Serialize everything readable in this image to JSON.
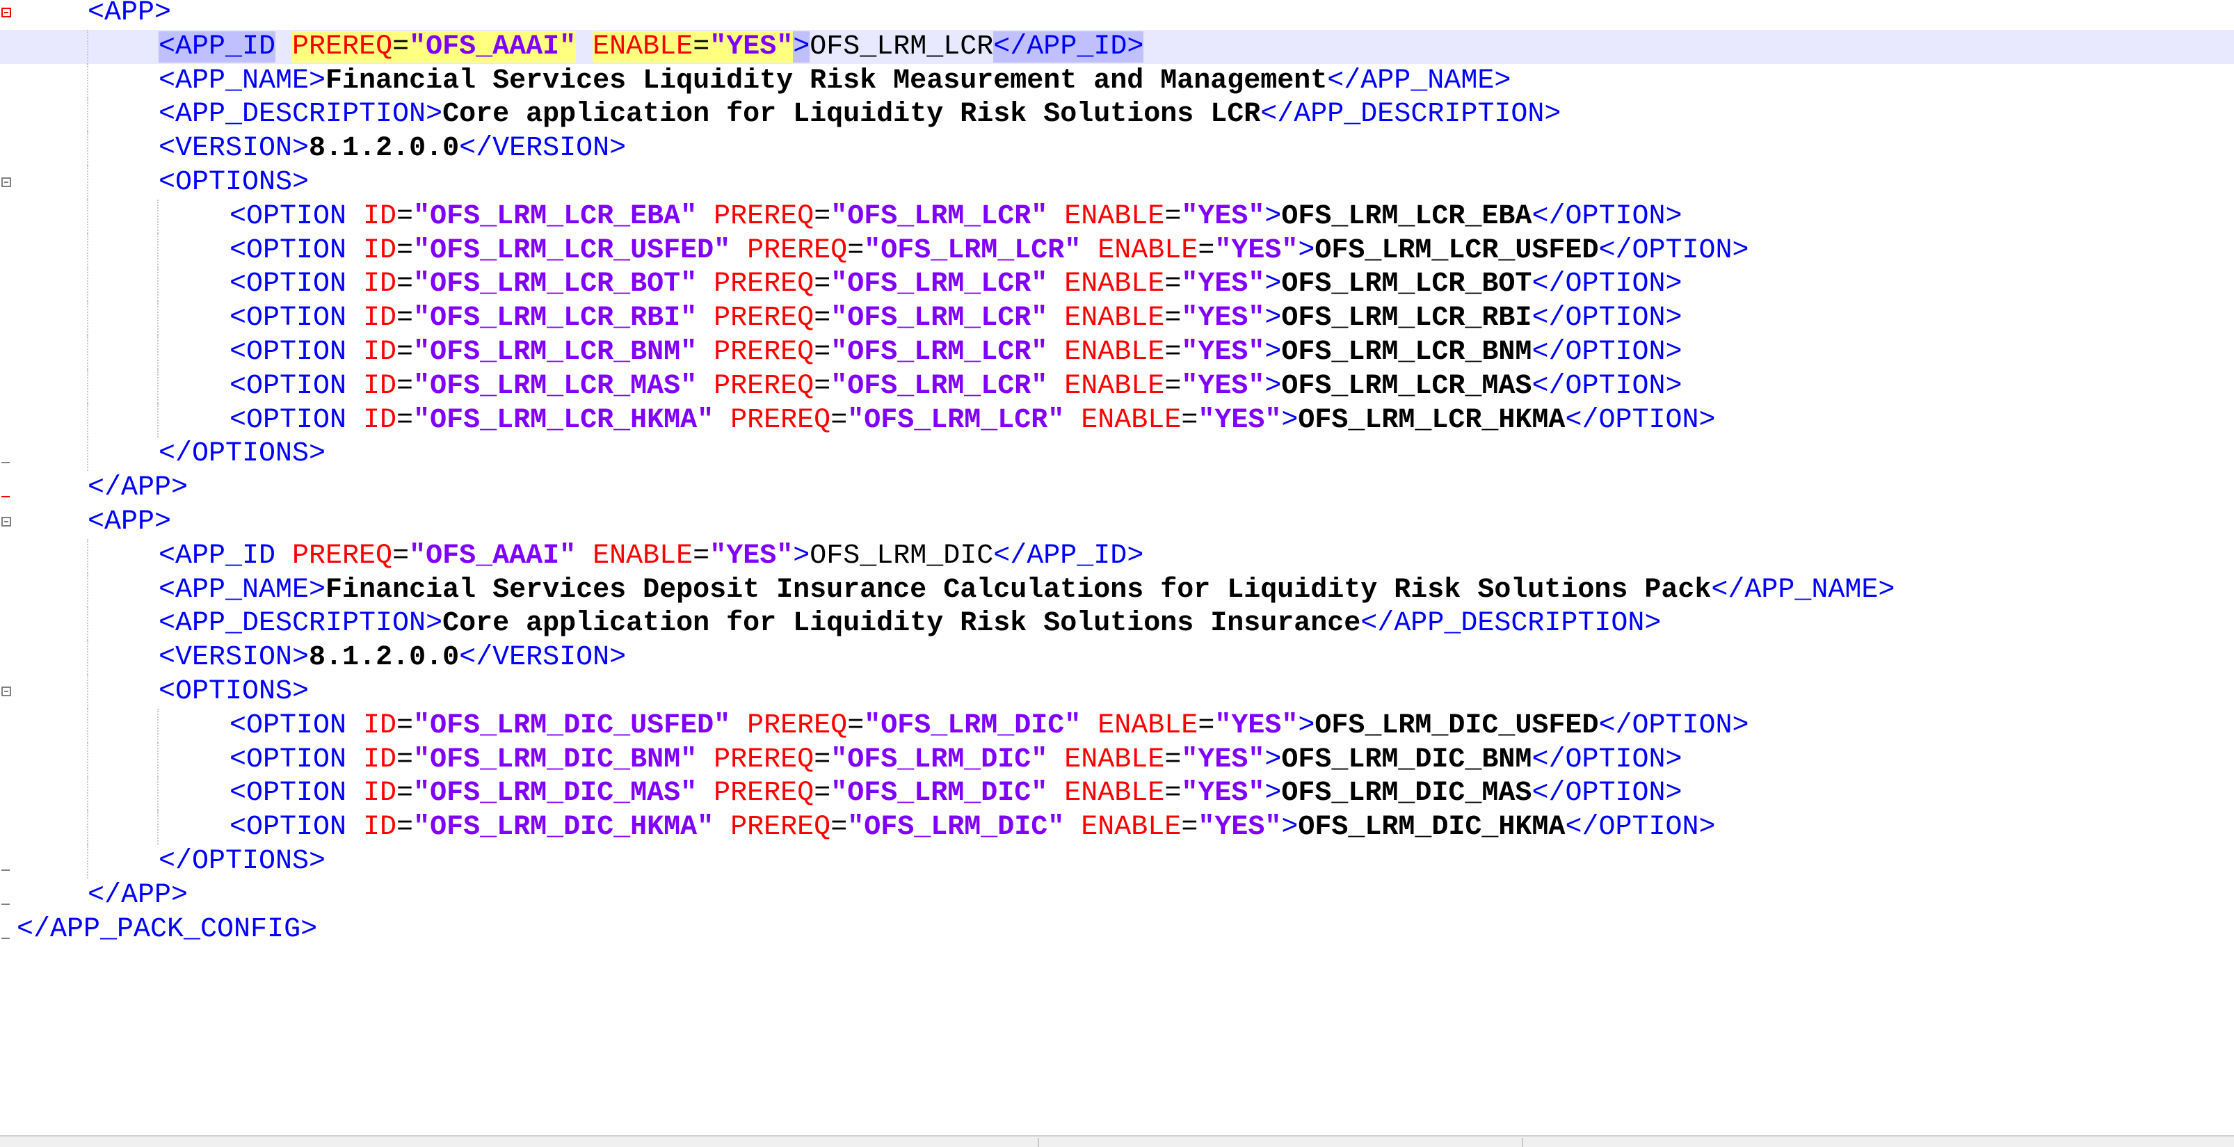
{
  "editor": {
    "lines": [
      {
        "indent": 1,
        "tokens": [
          [
            "tag",
            "<APP>"
          ]
        ]
      },
      {
        "indent": 2,
        "current": true,
        "tokens": [
          [
            "tag-sel",
            "<APP_ID"
          ],
          [
            "sp",
            " "
          ],
          [
            "attr-yel",
            "PREREQ"
          ],
          [
            "eq-yel",
            "="
          ],
          [
            "val-yel",
            "\"OFS_AAAI\""
          ],
          [
            "sp",
            " "
          ],
          [
            "attr-yel",
            "ENABLE"
          ],
          [
            "eq-yel",
            "="
          ],
          [
            "val-yel",
            "\"YES"
          ],
          [
            "caret",
            ""
          ],
          [
            "val-yel",
            "\""
          ],
          [
            "tag-sel",
            ">"
          ],
          [
            "txt-plain",
            "OFS_LRM_LCR"
          ],
          [
            "tag-sel",
            "</APP_ID>"
          ]
        ]
      },
      {
        "indent": 2,
        "tokens": [
          [
            "tag",
            "<APP_NAME>"
          ],
          [
            "txt",
            "Financial Services Liquidity Risk Measurement and Management"
          ],
          [
            "tag",
            "</APP_NAME>"
          ]
        ]
      },
      {
        "indent": 2,
        "tokens": [
          [
            "tag",
            "<APP_DESCRIPTION>"
          ],
          [
            "txt",
            "Core application for Liquidity Risk Solutions LCR"
          ],
          [
            "tag",
            "</APP_DESCRIPTION>"
          ]
        ]
      },
      {
        "indent": 2,
        "tokens": [
          [
            "tag",
            "<VERSION>"
          ],
          [
            "txt",
            "8.1.2.0.0"
          ],
          [
            "tag",
            "</VERSION>"
          ]
        ]
      },
      {
        "indent": 2,
        "tokens": [
          [
            "tag",
            "<OPTIONS>"
          ]
        ]
      },
      {
        "indent": 3,
        "tokens": [
          [
            "tag",
            "<OPTION "
          ],
          [
            "attr",
            "ID"
          ],
          [
            "eq",
            "="
          ],
          [
            "val",
            "\"OFS_LRM_LCR_EBA\""
          ],
          [
            "sp",
            " "
          ],
          [
            "attr",
            "PREREQ"
          ],
          [
            "eq",
            "="
          ],
          [
            "val",
            "\"OFS_LRM_LCR\""
          ],
          [
            "sp",
            " "
          ],
          [
            "attr",
            "ENABLE"
          ],
          [
            "eq",
            "="
          ],
          [
            "val",
            "\"YES\""
          ],
          [
            "tag",
            ">"
          ],
          [
            "txt",
            "OFS_LRM_LCR_EBA"
          ],
          [
            "tag",
            "</OPTION>"
          ]
        ]
      },
      {
        "indent": 3,
        "tokens": [
          [
            "tag",
            "<OPTION "
          ],
          [
            "attr",
            "ID"
          ],
          [
            "eq",
            "="
          ],
          [
            "val",
            "\"OFS_LRM_LCR_USFED\""
          ],
          [
            "sp",
            " "
          ],
          [
            "attr",
            "PREREQ"
          ],
          [
            "eq",
            "="
          ],
          [
            "val",
            "\"OFS_LRM_LCR\""
          ],
          [
            "sp",
            " "
          ],
          [
            "attr",
            "ENABLE"
          ],
          [
            "eq",
            "="
          ],
          [
            "val",
            "\"YES\""
          ],
          [
            "tag",
            ">"
          ],
          [
            "txt",
            "OFS_LRM_LCR_USFED"
          ],
          [
            "tag",
            "</OPTION>"
          ]
        ]
      },
      {
        "indent": 3,
        "tokens": [
          [
            "tag",
            "<OPTION "
          ],
          [
            "attr",
            "ID"
          ],
          [
            "eq",
            "="
          ],
          [
            "val",
            "\"OFS_LRM_LCR_BOT\""
          ],
          [
            "sp",
            " "
          ],
          [
            "attr",
            "PREREQ"
          ],
          [
            "eq",
            "="
          ],
          [
            "val",
            "\"OFS_LRM_LCR\""
          ],
          [
            "sp",
            " "
          ],
          [
            "attr",
            "ENABLE"
          ],
          [
            "eq",
            "="
          ],
          [
            "val",
            "\"YES\""
          ],
          [
            "tag",
            ">"
          ],
          [
            "txt",
            "OFS_LRM_LCR_BOT"
          ],
          [
            "tag",
            "</OPTION>"
          ]
        ]
      },
      {
        "indent": 3,
        "tokens": [
          [
            "tag",
            "<OPTION "
          ],
          [
            "attr",
            "ID"
          ],
          [
            "eq",
            "="
          ],
          [
            "val",
            "\"OFS_LRM_LCR_RBI\""
          ],
          [
            "sp",
            " "
          ],
          [
            "attr",
            "PREREQ"
          ],
          [
            "eq",
            "="
          ],
          [
            "val",
            "\"OFS_LRM_LCR\""
          ],
          [
            "sp",
            " "
          ],
          [
            "attr",
            "ENABLE"
          ],
          [
            "eq",
            "="
          ],
          [
            "val",
            "\"YES\""
          ],
          [
            "tag",
            ">"
          ],
          [
            "txt",
            "OFS_LRM_LCR_RBI"
          ],
          [
            "tag",
            "</OPTION>"
          ]
        ]
      },
      {
        "indent": 3,
        "tokens": [
          [
            "tag",
            "<OPTION "
          ],
          [
            "attr",
            "ID"
          ],
          [
            "eq",
            "="
          ],
          [
            "val",
            "\"OFS_LRM_LCR_BNM\""
          ],
          [
            "sp",
            " "
          ],
          [
            "attr",
            "PREREQ"
          ],
          [
            "eq",
            "="
          ],
          [
            "val",
            "\"OFS_LRM_LCR\""
          ],
          [
            "sp",
            " "
          ],
          [
            "attr",
            "ENABLE"
          ],
          [
            "eq",
            "="
          ],
          [
            "val",
            "\"YES\""
          ],
          [
            "tag",
            ">"
          ],
          [
            "txt",
            "OFS_LRM_LCR_BNM"
          ],
          [
            "tag",
            "</OPTION>"
          ]
        ]
      },
      {
        "indent": 3,
        "tokens": [
          [
            "tag",
            "<OPTION "
          ],
          [
            "attr",
            "ID"
          ],
          [
            "eq",
            "="
          ],
          [
            "val",
            "\"OFS_LRM_LCR_MAS\""
          ],
          [
            "sp",
            " "
          ],
          [
            "attr",
            "PREREQ"
          ],
          [
            "eq",
            "="
          ],
          [
            "val",
            "\"OFS_LRM_LCR\""
          ],
          [
            "sp",
            " "
          ],
          [
            "attr",
            "ENABLE"
          ],
          [
            "eq",
            "="
          ],
          [
            "val",
            "\"YES\""
          ],
          [
            "tag",
            ">"
          ],
          [
            "txt",
            "OFS_LRM_LCR_MAS"
          ],
          [
            "tag",
            "</OPTION>"
          ]
        ]
      },
      {
        "indent": 3,
        "tokens": [
          [
            "tag",
            "<OPTION "
          ],
          [
            "attr",
            "ID"
          ],
          [
            "eq",
            "="
          ],
          [
            "val",
            "\"OFS_LRM_LCR_HKMA\""
          ],
          [
            "sp",
            " "
          ],
          [
            "attr",
            "PREREQ"
          ],
          [
            "eq",
            "="
          ],
          [
            "val",
            "\"OFS_LRM_LCR\""
          ],
          [
            "sp",
            " "
          ],
          [
            "attr",
            "ENABLE"
          ],
          [
            "eq",
            "="
          ],
          [
            "val",
            "\"YES\""
          ],
          [
            "tag",
            ">"
          ],
          [
            "txt",
            "OFS_LRM_LCR_HKMA"
          ],
          [
            "tag",
            "</OPTION>"
          ]
        ]
      },
      {
        "indent": 2,
        "tokens": [
          [
            "tag",
            "</OPTIONS>"
          ]
        ]
      },
      {
        "indent": 1,
        "tokens": [
          [
            "tag",
            "</APP>"
          ]
        ]
      },
      {
        "indent": 1,
        "tokens": [
          [
            "tag",
            "<APP>"
          ]
        ]
      },
      {
        "indent": 2,
        "tokens": [
          [
            "tag",
            "<APP_ID "
          ],
          [
            "attr",
            "PREREQ"
          ],
          [
            "eq",
            "="
          ],
          [
            "val",
            "\"OFS_AAAI\""
          ],
          [
            "sp",
            " "
          ],
          [
            "attr",
            "ENABLE"
          ],
          [
            "eq",
            "="
          ],
          [
            "val",
            "\"YES\""
          ],
          [
            "tag",
            ">"
          ],
          [
            "txt-plain",
            "OFS_LRM_DIC"
          ],
          [
            "tag",
            "</APP_ID>"
          ]
        ]
      },
      {
        "indent": 2,
        "tokens": [
          [
            "tag",
            "<APP_NAME>"
          ],
          [
            "txt",
            "Financial Services Deposit Insurance Calculations for Liquidity Risk Solutions Pack"
          ],
          [
            "tag",
            "</APP_NAME>"
          ]
        ]
      },
      {
        "indent": 2,
        "tokens": [
          [
            "tag",
            "<APP_DESCRIPTION>"
          ],
          [
            "txt",
            "Core application for Liquidity Risk Solutions Insurance"
          ],
          [
            "tag",
            "</APP_DESCRIPTION>"
          ]
        ]
      },
      {
        "indent": 2,
        "tokens": [
          [
            "tag",
            "<VERSION>"
          ],
          [
            "txt",
            "8.1.2.0.0"
          ],
          [
            "tag",
            "</VERSION>"
          ]
        ]
      },
      {
        "indent": 2,
        "tokens": [
          [
            "tag",
            "<OPTIONS>"
          ]
        ]
      },
      {
        "indent": 3,
        "tokens": [
          [
            "tag",
            "<OPTION "
          ],
          [
            "attr",
            "ID"
          ],
          [
            "eq",
            "="
          ],
          [
            "val",
            "\"OFS_LRM_DIC_USFED\""
          ],
          [
            "sp",
            " "
          ],
          [
            "attr",
            "PREREQ"
          ],
          [
            "eq",
            "="
          ],
          [
            "val",
            "\"OFS_LRM_DIC\""
          ],
          [
            "sp",
            " "
          ],
          [
            "attr",
            "ENABLE"
          ],
          [
            "eq",
            "="
          ],
          [
            "val",
            "\"YES\""
          ],
          [
            "tag",
            ">"
          ],
          [
            "txt",
            "OFS_LRM_DIC_USFED"
          ],
          [
            "tag",
            "</OPTION>"
          ]
        ]
      },
      {
        "indent": 3,
        "tokens": [
          [
            "tag",
            "<OPTION "
          ],
          [
            "attr",
            "ID"
          ],
          [
            "eq",
            "="
          ],
          [
            "val",
            "\"OFS_LRM_DIC_BNM\""
          ],
          [
            "sp",
            " "
          ],
          [
            "attr",
            "PREREQ"
          ],
          [
            "eq",
            "="
          ],
          [
            "val",
            "\"OFS_LRM_DIC\""
          ],
          [
            "sp",
            " "
          ],
          [
            "attr",
            "ENABLE"
          ],
          [
            "eq",
            "="
          ],
          [
            "val",
            "\"YES\""
          ],
          [
            "tag",
            ">"
          ],
          [
            "txt",
            "OFS_LRM_DIC_BNM"
          ],
          [
            "tag",
            "</OPTION>"
          ]
        ]
      },
      {
        "indent": 3,
        "tokens": [
          [
            "tag",
            "<OPTION "
          ],
          [
            "attr",
            "ID"
          ],
          [
            "eq",
            "="
          ],
          [
            "val",
            "\"OFS_LRM_DIC_MAS\""
          ],
          [
            "sp",
            " "
          ],
          [
            "attr",
            "PREREQ"
          ],
          [
            "eq",
            "="
          ],
          [
            "val",
            "\"OFS_LRM_DIC\""
          ],
          [
            "sp",
            " "
          ],
          [
            "attr",
            "ENABLE"
          ],
          [
            "eq",
            "="
          ],
          [
            "val",
            "\"YES\""
          ],
          [
            "tag",
            ">"
          ],
          [
            "txt",
            "OFS_LRM_DIC_MAS"
          ],
          [
            "tag",
            "</OPTION>"
          ]
        ]
      },
      {
        "indent": 3,
        "tokens": [
          [
            "tag",
            "<OPTION "
          ],
          [
            "attr",
            "ID"
          ],
          [
            "eq",
            "="
          ],
          [
            "val",
            "\"OFS_LRM_DIC_HKMA\""
          ],
          [
            "sp",
            " "
          ],
          [
            "attr",
            "PREREQ"
          ],
          [
            "eq",
            "="
          ],
          [
            "val",
            "\"OFS_LRM_DIC\""
          ],
          [
            "sp",
            " "
          ],
          [
            "attr",
            "ENABLE"
          ],
          [
            "eq",
            "="
          ],
          [
            "val",
            "\"YES\""
          ],
          [
            "tag",
            ">"
          ],
          [
            "txt",
            "OFS_LRM_DIC_HKMA"
          ],
          [
            "tag",
            "</OPTION>"
          ]
        ]
      },
      {
        "indent": 2,
        "tokens": [
          [
            "tag",
            "</OPTIONS>"
          ]
        ]
      },
      {
        "indent": 1,
        "tokens": [
          [
            "tag",
            "</APP>"
          ]
        ]
      },
      {
        "indent": 0,
        "tokens": [
          [
            "tag",
            "</APP_PACK_CONFIG>"
          ]
        ]
      }
    ],
    "fold_markers": [
      {
        "line": 0,
        "kind": "box",
        "color": "red"
      },
      {
        "line": 5,
        "kind": "box",
        "color": "gray"
      },
      {
        "line": 13,
        "kind": "end",
        "color": "gray"
      },
      {
        "line": 14,
        "kind": "end",
        "color": "red"
      },
      {
        "line": 15,
        "kind": "box",
        "color": "gray"
      },
      {
        "line": 20,
        "kind": "box",
        "color": "gray"
      },
      {
        "line": 25,
        "kind": "end",
        "color": "gray"
      },
      {
        "line": 26,
        "kind": "end",
        "color": "gray"
      },
      {
        "line": 27,
        "kind": "end",
        "color": "gray"
      }
    ]
  }
}
